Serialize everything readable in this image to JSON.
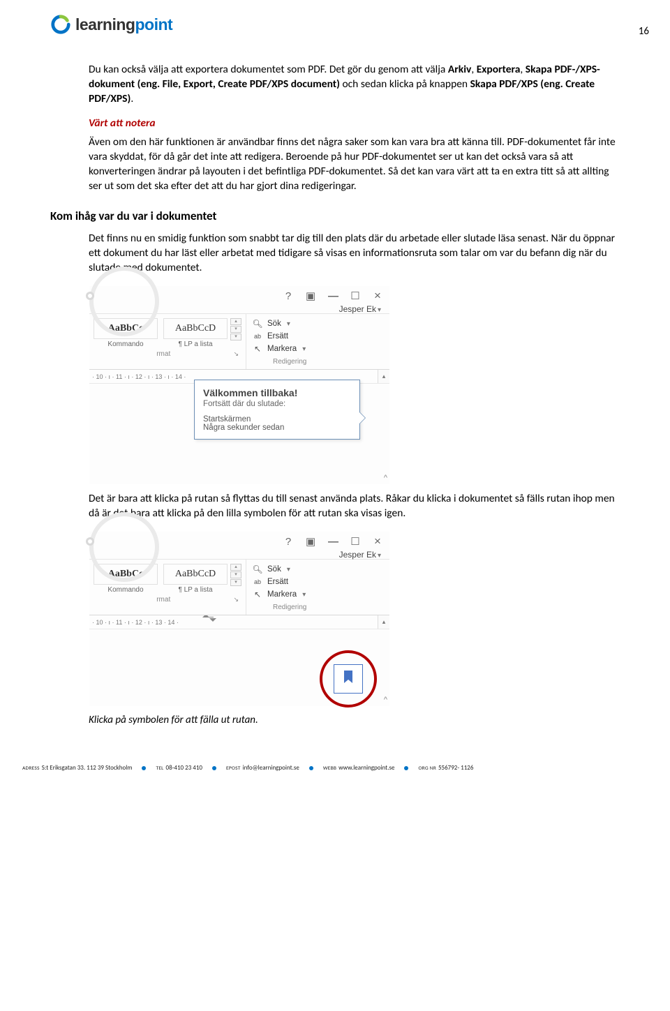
{
  "page_number": "16",
  "logo": {
    "part1": "learning",
    "part2": "point"
  },
  "body": {
    "p1_a": "Du kan också välja att exportera dokumentet som PDF. Det gör du genom att välja ",
    "p1_b1": "Arkiv",
    "p1_c": ", ",
    "p1_b2": "Exportera",
    "p1_d": ", ",
    "p1_b3": "Skapa PDF-/XPS-dokument (eng. File, Export, Create PDF/XPS document)",
    "p1_e": " och sedan klicka på knappen ",
    "p1_b4": "Skapa PDF/XPS (eng. Create PDF/XPS)",
    "p1_f": ".",
    "note_heading": "Värt att notera",
    "p2": "Även om den här funktionen är användbar finns det några saker som kan vara bra att känna till. PDF-dokumentet får inte vara skyddat, för då går det inte att redigera. Beroende på hur PDF-dokumentet ser ut kan det också vara så att konverteringen ändrar på layouten i det befintliga PDF-dokumentet. Så det kan vara värt att ta en extra titt så att allting ser ut som det ska efter det att du har gjort dina redigeringar.",
    "h2": "Kom ihåg var du var i dokumentet",
    "p3": "Det finns nu en smidig funktion som snabbt tar dig till den plats där du arbetade eller slutade läsa senast. När du öppnar ett dokument du har läst eller arbetat med tidigare så visas en informationsruta som talar om var du befann dig när du slutade med dokumentet.",
    "p4": "Det är bara att klicka på rutan så flyttas du till senast använda plats. Råkar du klicka i dokumentet så fälls rutan ihop men då är det bara att klicka på den lilla symbolen för att rutan ska visas igen.",
    "caption": "Klicka på symbolen för att fälla ut rutan."
  },
  "word_shot": {
    "user": "Jesper Ek",
    "style1_sample": "AaBbCc",
    "style2_sample": "AaBbCcD",
    "style1_name": "Kommando",
    "style2_name": "¶ LP a lista",
    "group_styles": "rmat",
    "group_edit": "Redigering",
    "edit_find": "Sök",
    "edit_replace": "Ersätt",
    "edit_select": "Markera",
    "ruler_a": "· 10 · ı · 11 · ı · 12 · ı · 13 · ı · 14 · ",
    "ruler_b": "· 10 · ı · 11 · ı · 12 · ı · 13      · 14 ·",
    "callout_title": "Välkommen tillbaka!",
    "callout_sub": "Fortsätt där du slutade:",
    "callout_l1": "Startskärmen",
    "callout_l2": "Några sekunder sedan"
  },
  "footer": {
    "addr_lbl": "ADRESS",
    "addr": "S:t Eriksgatan 33. 112 39 Stockholm",
    "tel_lbl": "TEL",
    "tel": "08-410 23 410",
    "email_lbl": "EPOST",
    "email": "info@learningpoint.se",
    "web_lbl": "WEBB",
    "web": "www.learningpoint.se",
    "org_lbl": "ORG NR",
    "org": "556792- 1126"
  }
}
